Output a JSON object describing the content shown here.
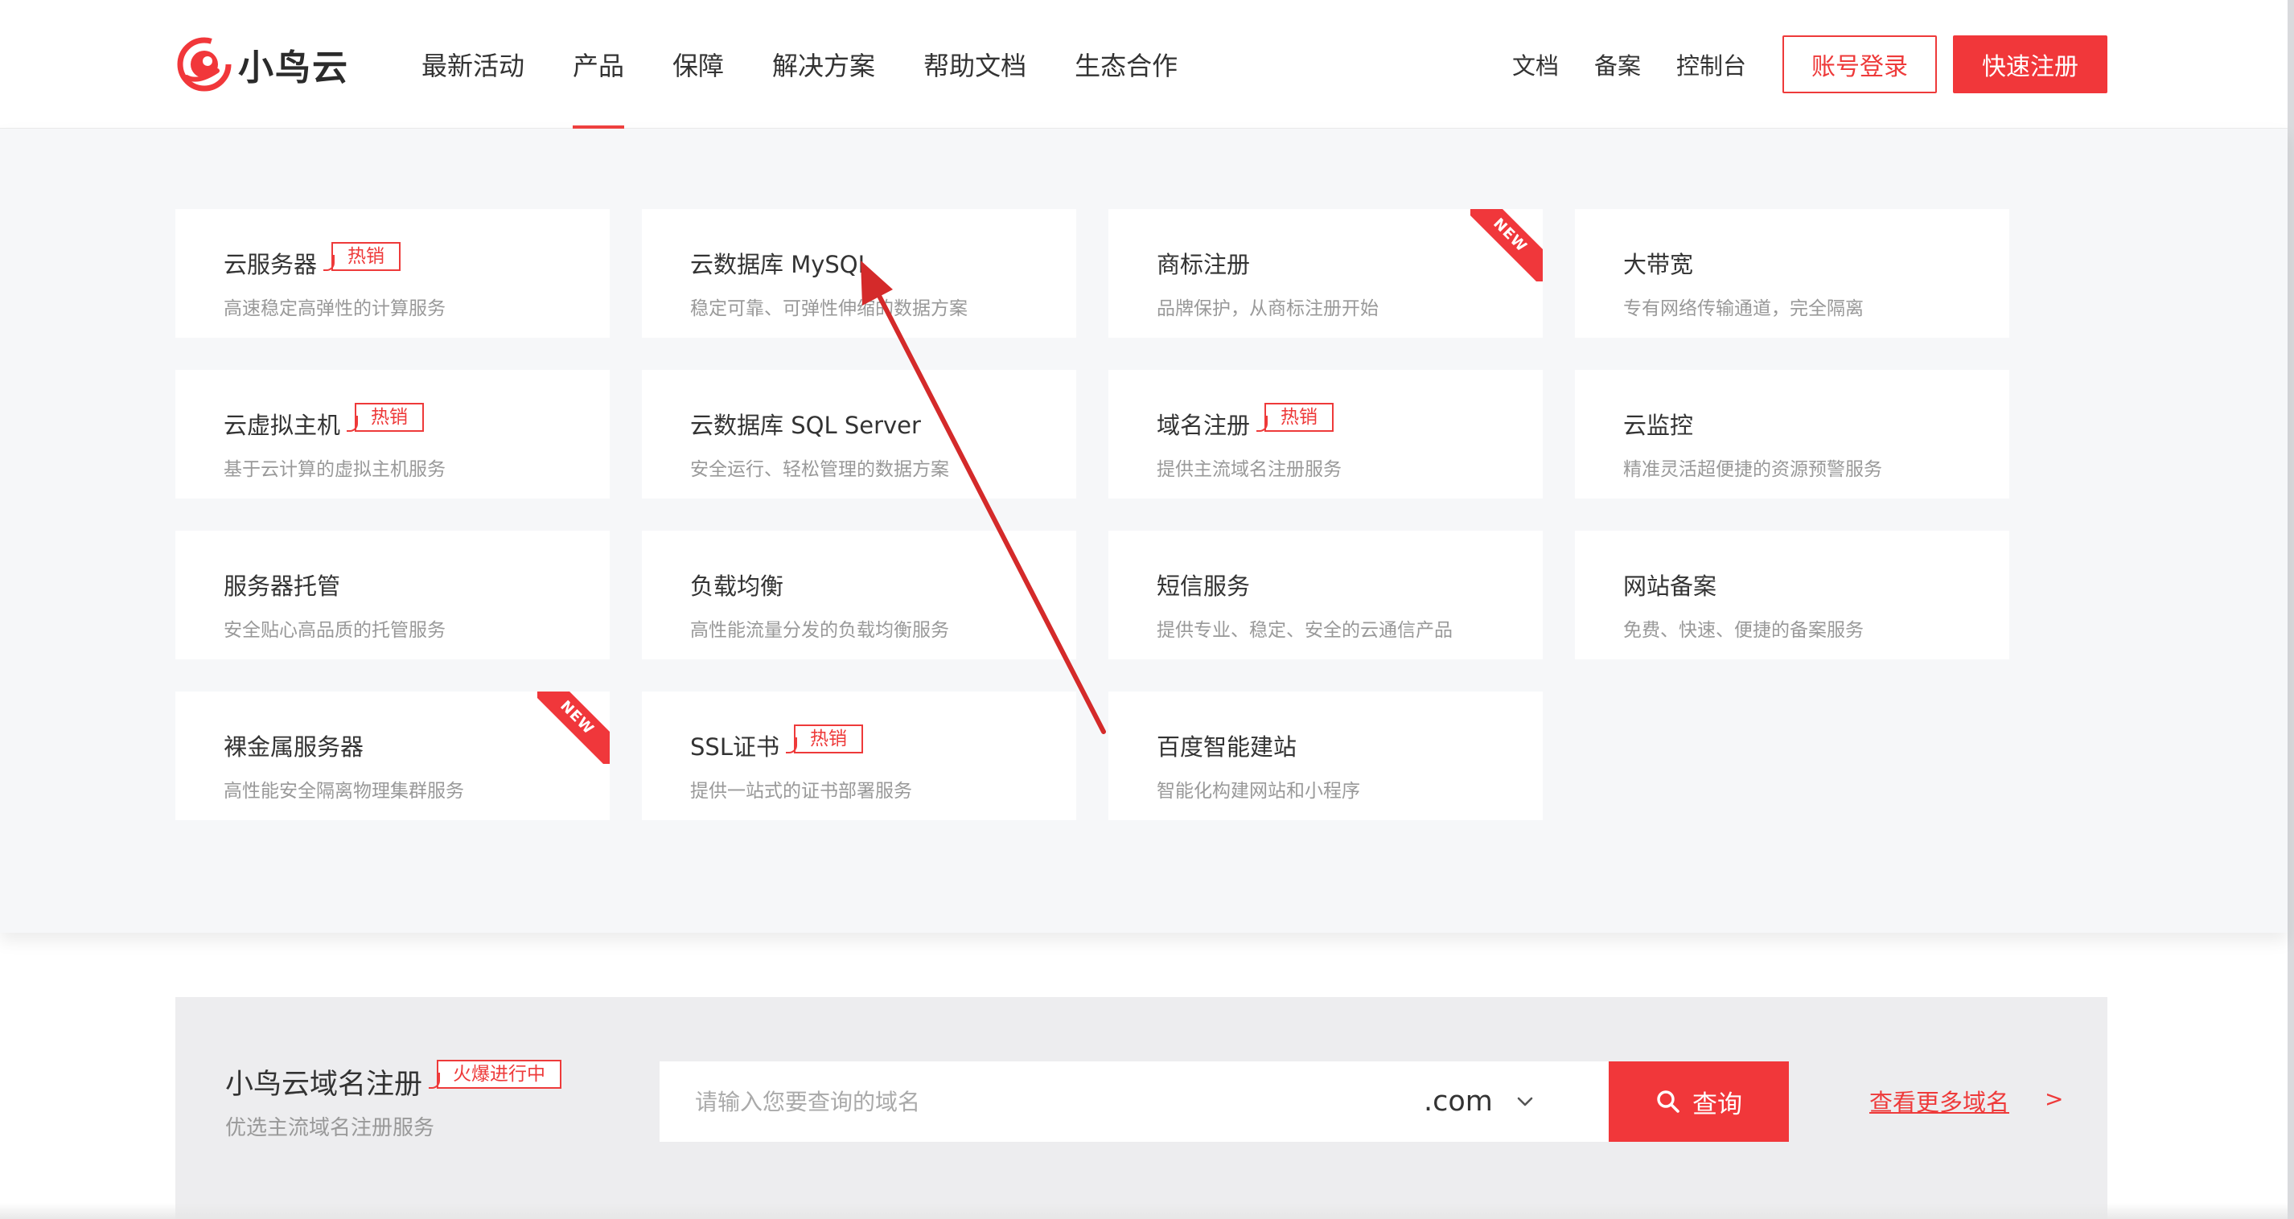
{
  "brand": {
    "name": "小鸟云",
    "accent_color": "#f1373a"
  },
  "nav": {
    "items": [
      {
        "label": "最新活动",
        "active": false
      },
      {
        "label": "产品",
        "active": true
      },
      {
        "label": "保障",
        "active": false
      },
      {
        "label": "解决方案",
        "active": false
      },
      {
        "label": "帮助文档",
        "active": false
      },
      {
        "label": "生态合作",
        "active": false
      }
    ],
    "right_links": [
      "文档",
      "备案",
      "控制台"
    ],
    "login_label": "账号登录",
    "register_label": "快速注册"
  },
  "products": [
    {
      "title": "云服务器",
      "desc": "高速稳定高弹性的计算服务",
      "badge": "热销",
      "is_new": false
    },
    {
      "title": "云数据库 MySQL",
      "desc": "稳定可靠、可弹性伸缩的数据方案",
      "badge": "",
      "is_new": false
    },
    {
      "title": "商标注册",
      "desc": "品牌保护，从商标注册开始",
      "badge": "",
      "is_new": true
    },
    {
      "title": "大带宽",
      "desc": "专有网络传输通道，完全隔离",
      "badge": "",
      "is_new": false
    },
    {
      "title": "云虚拟主机",
      "desc": "基于云计算的虚拟主机服务",
      "badge": "热销",
      "is_new": false
    },
    {
      "title": "云数据库 SQL Server",
      "desc": "安全运行、轻松管理的数据方案",
      "badge": "",
      "is_new": false
    },
    {
      "title": "域名注册",
      "desc": "提供主流域名注册服务",
      "badge": "热销",
      "is_new": false
    },
    {
      "title": "云监控",
      "desc": "精准灵活超便捷的资源预警服务",
      "badge": "",
      "is_new": false
    },
    {
      "title": "服务器托管",
      "desc": "安全贴心高品质的托管服务",
      "badge": "",
      "is_new": false
    },
    {
      "title": "负载均衡",
      "desc": "高性能流量分发的负载均衡服务",
      "badge": "",
      "is_new": false
    },
    {
      "title": "短信服务",
      "desc": "提供专业、稳定、安全的云通信产品",
      "badge": "",
      "is_new": false
    },
    {
      "title": "网站备案",
      "desc": "免费、快速、便捷的备案服务",
      "badge": "",
      "is_new": false
    },
    {
      "title": "裸金属服务器",
      "desc": "高性能安全隔离物理集群服务",
      "badge": "",
      "is_new": true
    },
    {
      "title": "SSL证书",
      "desc": "提供一站式的证书部署服务",
      "badge": "热销",
      "is_new": false
    },
    {
      "title": "百度智能建站",
      "desc": "智能化构建网站和小程序",
      "badge": "",
      "is_new": false
    }
  ],
  "new_ribbon_label": "NEW",
  "domain": {
    "title": "小鸟云域名注册",
    "badge": "火爆进行中",
    "subtitle": "优选主流域名注册服务",
    "placeholder": "请输入您要查询的域名",
    "suffix": ".com",
    "search_label": "查询",
    "more_label": "查看更多域名",
    "more_arrow": ">"
  },
  "annotation": {
    "color": "#d42a2a"
  }
}
